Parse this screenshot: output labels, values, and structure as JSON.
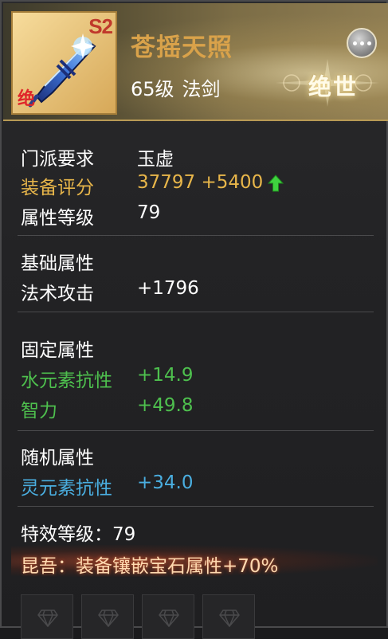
{
  "item": {
    "name": "苍摇天照",
    "level_text": "65级",
    "type_text": "法剑",
    "tier_tag": "S2",
    "quality_tag": "绝",
    "grade_text": "绝世"
  },
  "requirements": {
    "sect_label": "门派要求",
    "sect_value": "玉虚",
    "score_label": "装备评分",
    "score_value": "37797",
    "score_delta": "+5400",
    "attr_level_label": "属性等级",
    "attr_level_value": "79"
  },
  "base_attrs": {
    "title": "基础属性",
    "items": [
      {
        "label": "法术攻击",
        "value": "+1796"
      }
    ]
  },
  "fixed_attrs": {
    "title": "固定属性",
    "items": [
      {
        "label": "水元素抗性",
        "value": "+14.9"
      },
      {
        "label": "智力",
        "value": "+49.8"
      }
    ]
  },
  "random_attrs": {
    "title": "随机属性",
    "items": [
      {
        "label": "灵元素抗性",
        "value": "+34.0"
      }
    ]
  },
  "effect": {
    "level_text": "特效等级：79",
    "description": "昆吾：装备镶嵌宝石属性+70%"
  },
  "colors": {
    "gold": "#e8b64a",
    "green": "#4ec04e",
    "blue": "#4aaee0",
    "name": "#d9a24a"
  },
  "gem_slots": [
    "gem-slot-icon",
    "gem-slot-icon",
    "gem-slot-icon",
    "gem-slot-icon"
  ]
}
